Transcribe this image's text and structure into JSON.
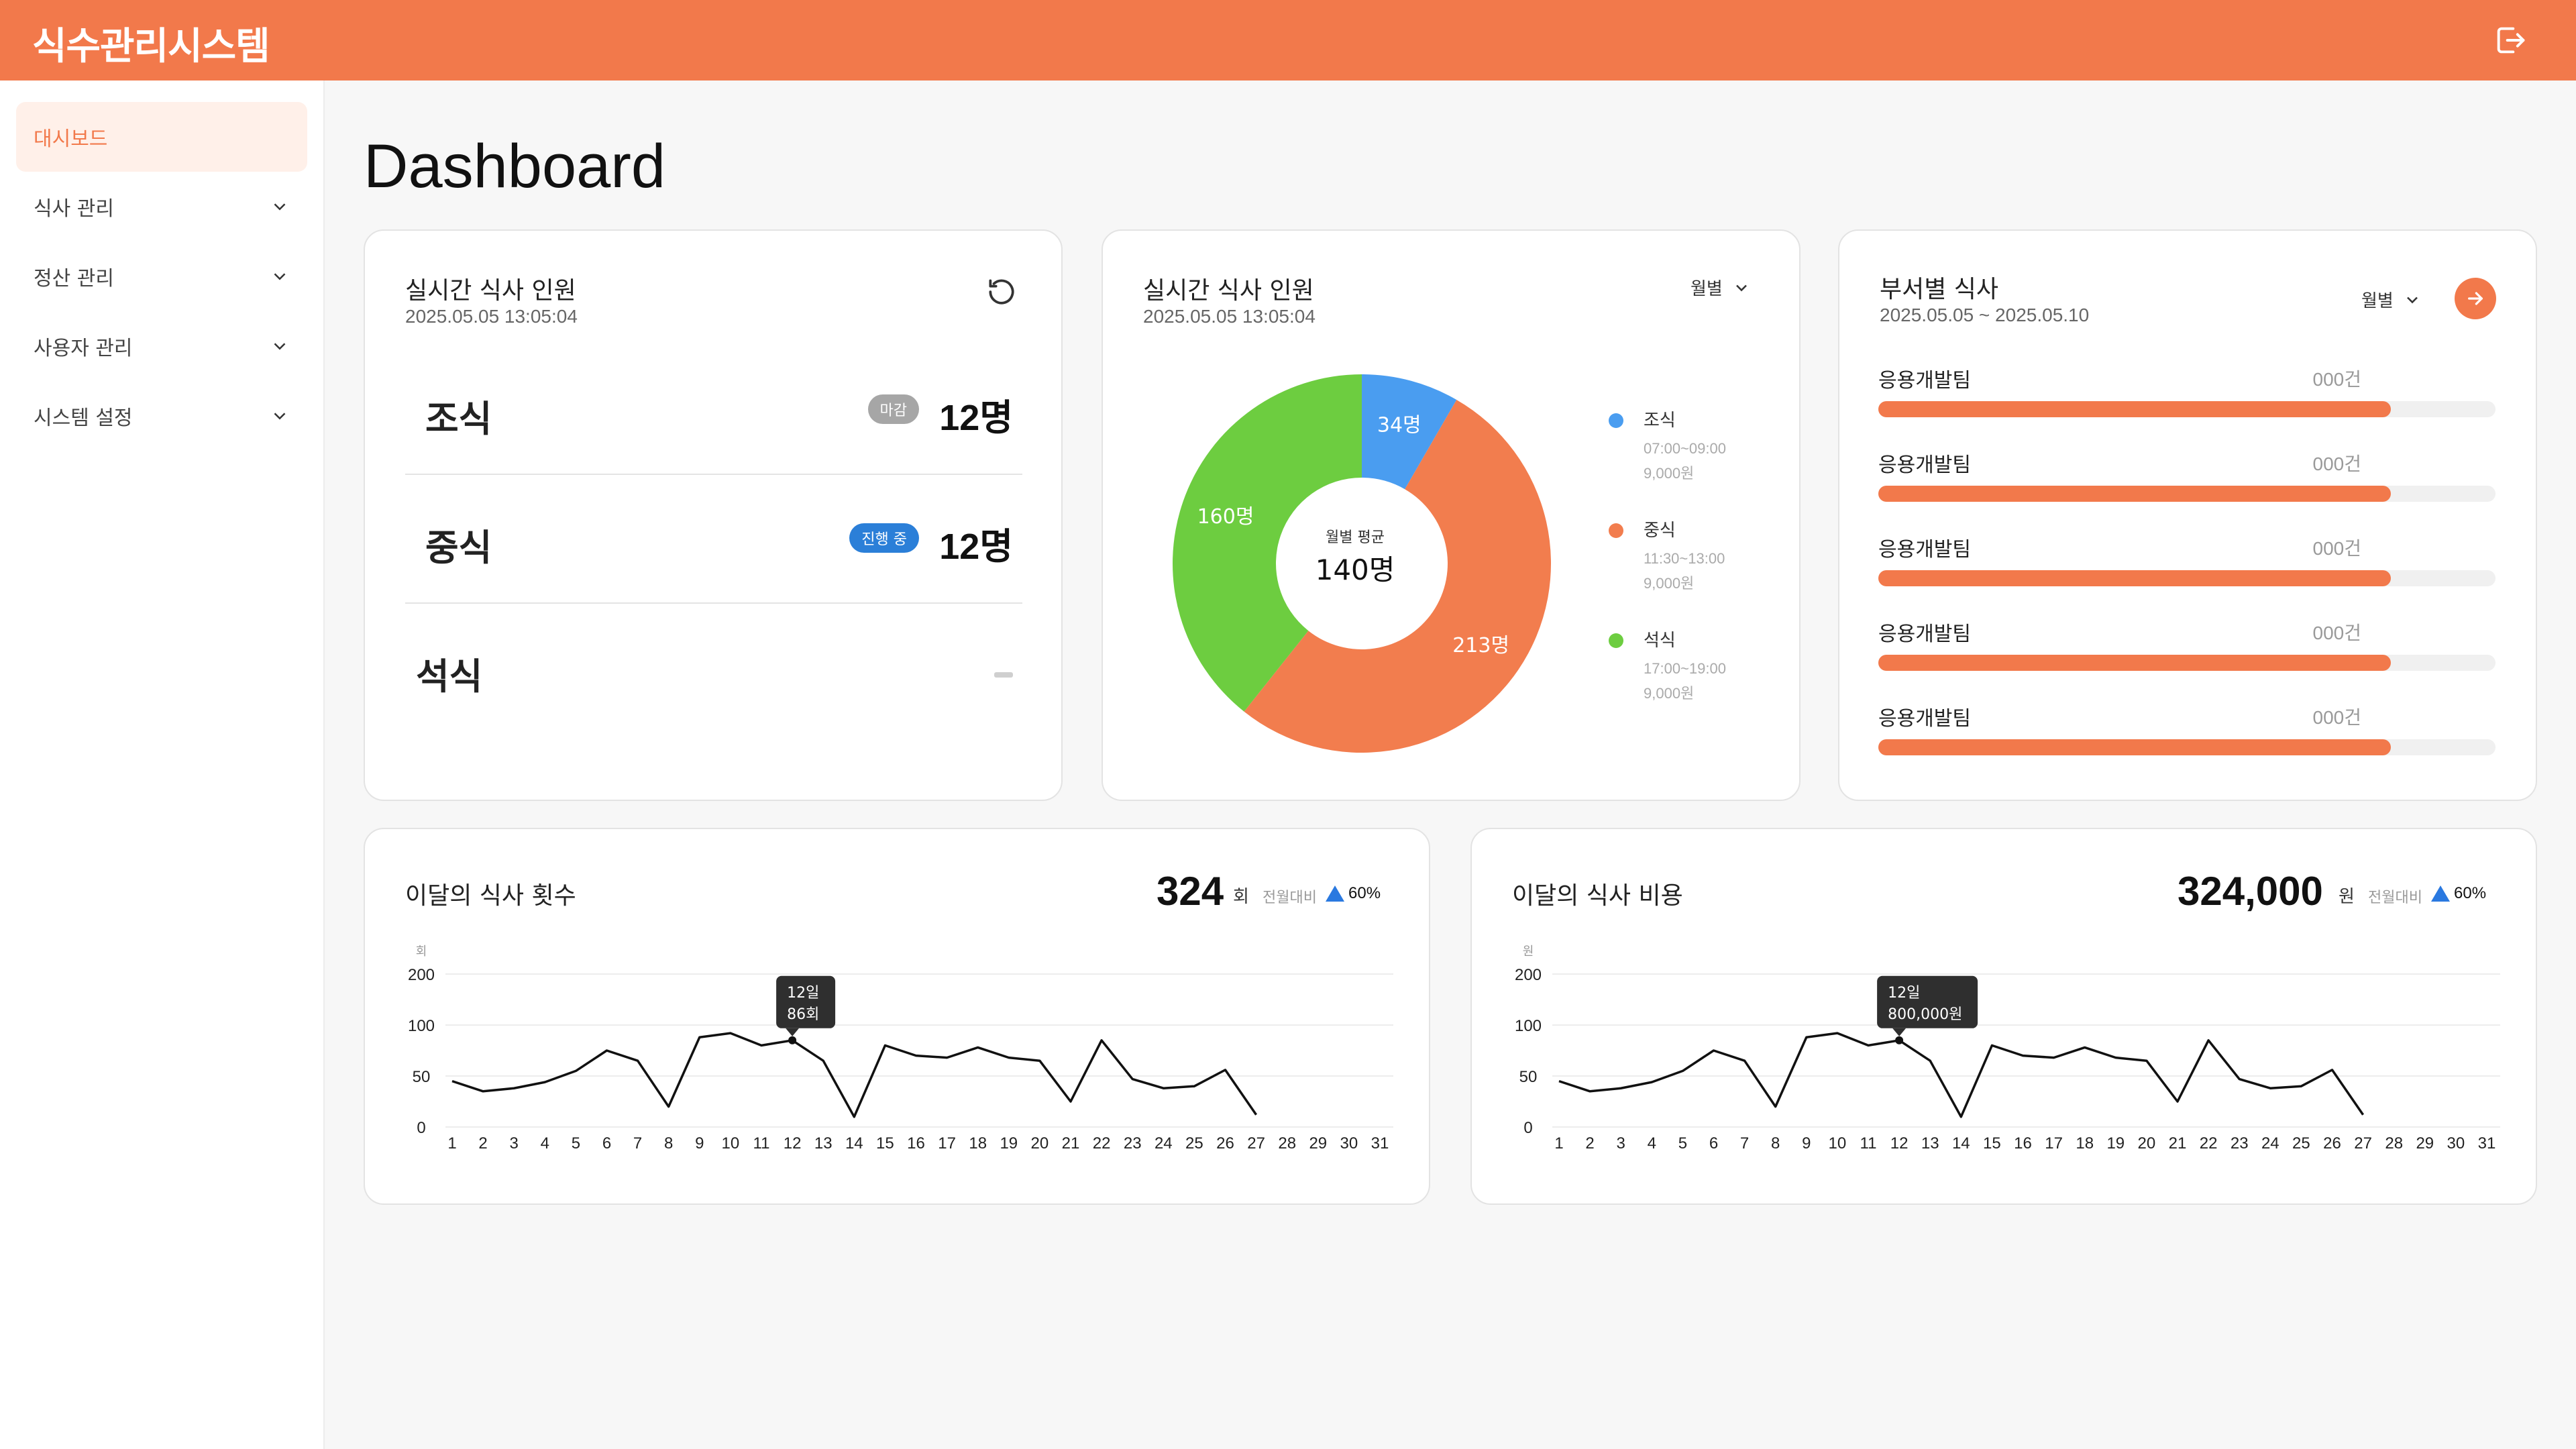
{
  "app": {
    "title": "식수관리시스템"
  },
  "sidebar": {
    "items": [
      {
        "label": "대시보드"
      },
      {
        "label": "식사 관리"
      },
      {
        "label": "정산 관리"
      },
      {
        "label": "사용자 관리"
      },
      {
        "label": "시스템 설정"
      }
    ]
  },
  "page": {
    "title": "Dashboard"
  },
  "realtime_card": {
    "title": "실시간 식사 인원",
    "datetime": "2025.05.05 13:05:04",
    "meals": [
      {
        "name": "조식",
        "status": "마감",
        "count": "12명",
        "status_color": "#a6a6a6"
      },
      {
        "name": "중식",
        "status": "진행 중",
        "count": "12명",
        "status_color": "#2b7fd8"
      },
      {
        "name": "석식",
        "status": "",
        "count": ""
      }
    ]
  },
  "donut_card": {
    "title": "실시간 식사 인원",
    "datetime": "2025.05.05 13:05:04",
    "period": "월별",
    "center_label": "월별 평균",
    "center_value": "140명",
    "legend": [
      {
        "name": "조식",
        "time": "07:00~09:00",
        "price": "9,000원",
        "color": "#4a9df0"
      },
      {
        "name": "중식",
        "time": "11:30~13:00",
        "price": "9,000원",
        "color": "#f27d4e"
      },
      {
        "name": "석식",
        "time": "17:00~19:00",
        "price": "9,000원",
        "color": "#6dcd40"
      }
    ],
    "chart_data": {
      "type": "pie",
      "labels": [
        "조식",
        "중식",
        "석식"
      ],
      "values": [
        34,
        213,
        160
      ],
      "value_labels": [
        "34명",
        "213명",
        "160명"
      ],
      "colors": [
        "#4a9df0",
        "#f27d4e",
        "#6dcd40"
      ]
    }
  },
  "dept_card": {
    "title": "부서별 식사",
    "date_range": "2025.05.05 ~ 2025.05.10",
    "period": "월별",
    "items": [
      {
        "name": "응용개발팀",
        "count": "000건",
        "ratio": 0.83
      },
      {
        "name": "응용개발팀",
        "count": "000건",
        "ratio": 0.83
      },
      {
        "name": "응용개발팀",
        "count": "000건",
        "ratio": 0.83
      },
      {
        "name": "응용개발팀",
        "count": "000건",
        "ratio": 0.83
      },
      {
        "name": "응용개발팀",
        "count": "000건",
        "ratio": 0.83
      }
    ]
  },
  "count_card": {
    "title": "이달의 식사 횟수",
    "total": "324",
    "unit": "회",
    "compare_label": "전월대비",
    "compare_value": "60%",
    "tooltip_day": "12일",
    "tooltip_value": "86회",
    "chart_data": {
      "type": "line",
      "ylabel": "회",
      "yticks": [
        "0",
        "50",
        "100",
        "200"
      ],
      "x": [
        1,
        2,
        3,
        4,
        5,
        6,
        7,
        8,
        9,
        10,
        11,
        12,
        13,
        14,
        15,
        16,
        17,
        18,
        19,
        20,
        21,
        22,
        23,
        24,
        25,
        26,
        27,
        28,
        29,
        30,
        31
      ],
      "values": [
        45,
        35,
        38,
        44,
        55,
        75,
        65,
        20,
        88,
        92,
        80,
        85,
        65,
        10,
        80,
        70,
        68,
        78,
        68,
        65,
        25,
        85,
        47,
        38,
        40,
        56,
        12,
        null,
        null,
        null,
        null
      ],
      "highlight_index": 11,
      "ylim": [
        0,
        200
      ]
    }
  },
  "cost_card": {
    "title": "이달의 식사 비용",
    "total": "324,000",
    "unit": "원",
    "compare_label": "전월대비",
    "compare_value": "60%",
    "tooltip_day": "12일",
    "tooltip_value": "800,000원",
    "chart_data": {
      "type": "line",
      "ylabel": "원",
      "yticks": [
        "0",
        "50",
        "100",
        "200"
      ],
      "x": [
        1,
        2,
        3,
        4,
        5,
        6,
        7,
        8,
        9,
        10,
        11,
        12,
        13,
        14,
        15,
        16,
        17,
        18,
        19,
        20,
        21,
        22,
        23,
        24,
        25,
        26,
        27,
        28,
        29,
        30,
        31
      ],
      "values": [
        45,
        35,
        38,
        44,
        55,
        75,
        65,
        20,
        88,
        92,
        80,
        85,
        65,
        10,
        80,
        70,
        68,
        78,
        68,
        65,
        25,
        85,
        47,
        38,
        40,
        56,
        12,
        null,
        null,
        null,
        null
      ],
      "highlight_index": 11,
      "ylim": [
        0,
        200
      ]
    }
  }
}
